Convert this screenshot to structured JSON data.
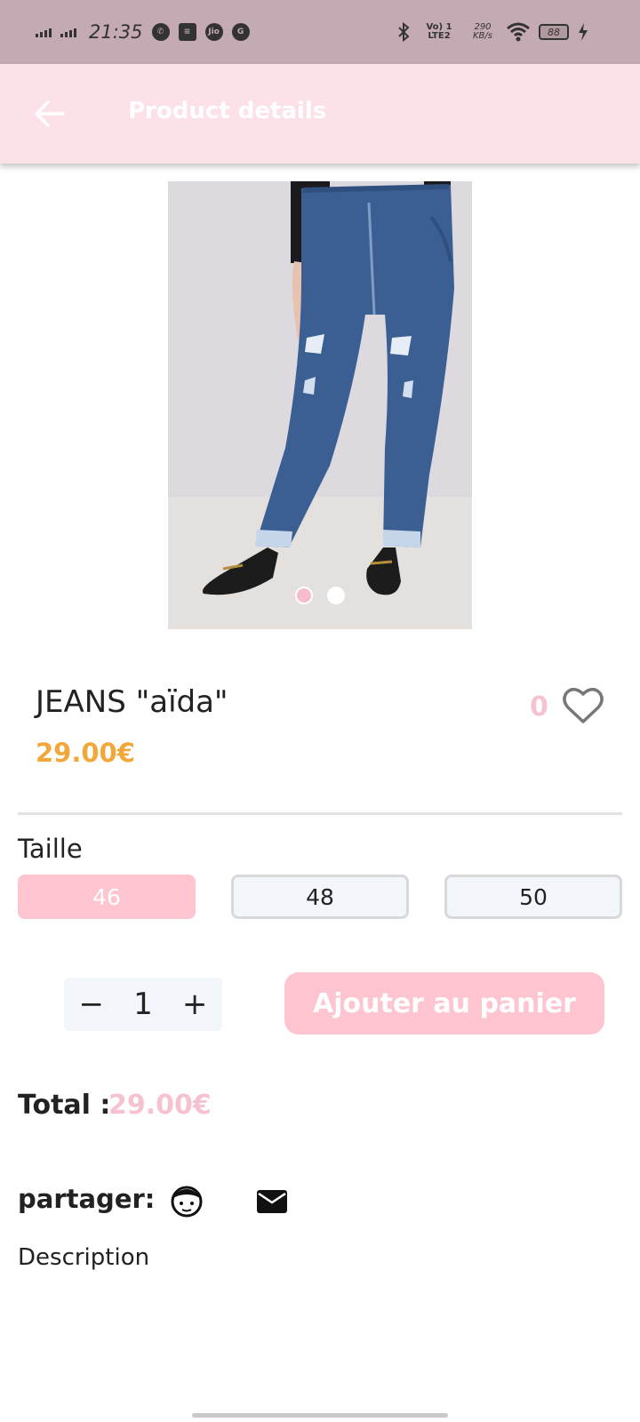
{
  "status_bar": {
    "time": "21:35",
    "network": "Vo) 1 LTE2",
    "speed": "290 KB/s",
    "battery": "88",
    "left_icons": [
      "whatsapp-icon",
      "notes-icon",
      "jio-icon",
      "g-icon"
    ]
  },
  "app_bar": {
    "title": "Product details",
    "back_icon": "arrow-left-icon"
  },
  "product": {
    "name": "JEANS \"aïda\"",
    "price": "29.00€",
    "like_count": "0",
    "image_count": 2,
    "active_image_index": 0,
    "price_color": "#f2a73b"
  },
  "size": {
    "heading": "Taille",
    "options": [
      "46",
      "48",
      "50"
    ],
    "selected": "46"
  },
  "quantity": {
    "minus": "−",
    "value": "1",
    "plus": "+"
  },
  "cart": {
    "add_label": "Ajouter au panier"
  },
  "total": {
    "label": "Total :",
    "value": "29.00€"
  },
  "share": {
    "label": "partager:",
    "icons": [
      "facebook-icon",
      "mail-icon"
    ]
  },
  "description": {
    "label": "Description"
  },
  "colors": {
    "status_bar": "#c4aab2",
    "app_bar": "#fde1e8",
    "accent_pink": "#fec4cf",
    "price_orange": "#f2a73b"
  }
}
